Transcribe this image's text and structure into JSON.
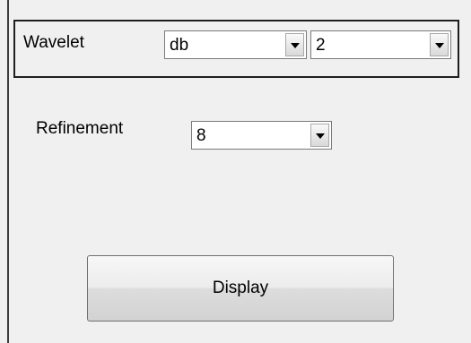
{
  "wavelet": {
    "label": "Wavelet",
    "family_value": "db",
    "order_value": "2"
  },
  "refinement": {
    "label": "Refinement",
    "value": "8"
  },
  "actions": {
    "display_label": "Display"
  },
  "icons": {
    "dropdown_arrow": "chevron-down-icon"
  }
}
